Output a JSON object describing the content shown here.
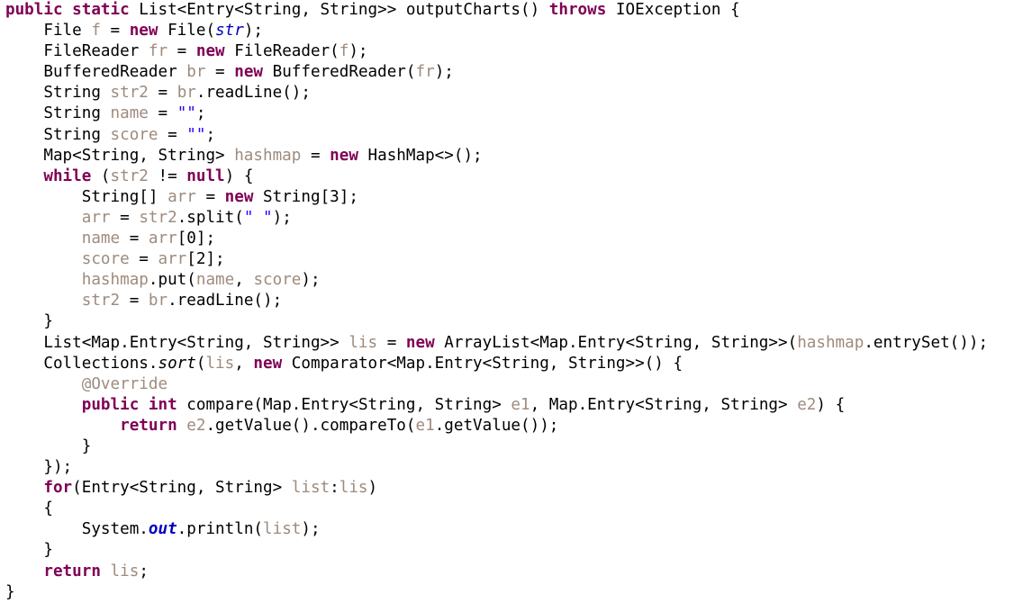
{
  "editor": {
    "language": "Java",
    "background_color": "#ffffff",
    "font_size_px": 17.6,
    "line_height_px": 23.1,
    "indent_spaces": 4
  },
  "theme": {
    "keyword_color": "#7f0055",
    "identifier_color": "#9e8b7d",
    "string_color": "#2a00ff",
    "field_color": "#0000c0",
    "static_field_color": "#0000c0",
    "plain_color": "#000000",
    "annotation_color": "#9e8b7d"
  },
  "code": {
    "plain_text": "public static List<Entry<String, String>> outputCharts() throws IOException {\n    File f = new File(str);\n    FileReader fr = new FileReader(f);\n    BufferedReader br = new BufferedReader(fr);\n    String str2 = br.readLine();\n    String name = \"\";\n    String score = \"\";\n    Map<String, String> hashmap = new HashMap<>();\n    while (str2 != null) {\n        String[] arr = new String[3];\n        arr = str2.split(\" \");\n        name = arr[0];\n        score = arr[2];\n        hashmap.put(name, score);\n        str2 = br.readLine();\n    }\n    List<Map.Entry<String, String>> lis = new ArrayList<Map.Entry<String, String>>(hashmap.entrySet());\n    Collections.sort(lis, new Comparator<Map.Entry<String, String>>() {\n        @Override\n        public int compare(Map.Entry<String, String> e1, Map.Entry<String, String> e2) {\n            return e2.getValue().compareTo(e1.getValue());\n        }\n    });\n    for(Entry<String, String> list:lis)\n    {\n        System.out.println(list);\n    }\n    return lis;\n}",
    "lines": [
      {
        "n": 1,
        "tokens": [
          {
            "c": "keyword",
            "s": "public static"
          },
          {
            "c": "plain",
            "s": " List<Entry<String, String>> outputCharts() "
          },
          {
            "c": "keyword",
            "s": "throws"
          },
          {
            "c": "plain",
            "s": " IOException {"
          }
        ]
      },
      {
        "n": 2,
        "tokens": [
          {
            "c": "plain",
            "s": "    File "
          },
          {
            "c": "ident",
            "s": "f"
          },
          {
            "c": "plain",
            "s": " = "
          },
          {
            "c": "keyword",
            "s": "new"
          },
          {
            "c": "plain",
            "s": " File("
          },
          {
            "c": "field",
            "s": "str"
          },
          {
            "c": "plain",
            "s": ");"
          }
        ]
      },
      {
        "n": 3,
        "tokens": [
          {
            "c": "plain",
            "s": "    FileReader "
          },
          {
            "c": "ident",
            "s": "fr"
          },
          {
            "c": "plain",
            "s": " = "
          },
          {
            "c": "keyword",
            "s": "new"
          },
          {
            "c": "plain",
            "s": " FileReader("
          },
          {
            "c": "ident",
            "s": "f"
          },
          {
            "c": "plain",
            "s": ");"
          }
        ]
      },
      {
        "n": 4,
        "tokens": [
          {
            "c": "plain",
            "s": "    BufferedReader "
          },
          {
            "c": "ident",
            "s": "br"
          },
          {
            "c": "plain",
            "s": " = "
          },
          {
            "c": "keyword",
            "s": "new"
          },
          {
            "c": "plain",
            "s": " BufferedReader("
          },
          {
            "c": "ident",
            "s": "fr"
          },
          {
            "c": "plain",
            "s": ");"
          }
        ]
      },
      {
        "n": 5,
        "tokens": [
          {
            "c": "plain",
            "s": "    String "
          },
          {
            "c": "ident",
            "s": "str2"
          },
          {
            "c": "plain",
            "s": " = "
          },
          {
            "c": "ident",
            "s": "br"
          },
          {
            "c": "plain",
            "s": ".readLine();"
          }
        ]
      },
      {
        "n": 6,
        "tokens": [
          {
            "c": "plain",
            "s": "    String "
          },
          {
            "c": "ident",
            "s": "name"
          },
          {
            "c": "plain",
            "s": " = "
          },
          {
            "c": "string",
            "s": "\"\""
          },
          {
            "c": "plain",
            "s": ";"
          }
        ]
      },
      {
        "n": 7,
        "tokens": [
          {
            "c": "plain",
            "s": "    String "
          },
          {
            "c": "ident",
            "s": "score"
          },
          {
            "c": "plain",
            "s": " = "
          },
          {
            "c": "string",
            "s": "\"\""
          },
          {
            "c": "plain",
            "s": ";"
          }
        ]
      },
      {
        "n": 8,
        "tokens": [
          {
            "c": "plain",
            "s": "    Map<String, String> "
          },
          {
            "c": "ident",
            "s": "hashmap"
          },
          {
            "c": "plain",
            "s": " = "
          },
          {
            "c": "keyword",
            "s": "new"
          },
          {
            "c": "plain",
            "s": " HashMap<>();"
          }
        ]
      },
      {
        "n": 9,
        "tokens": [
          {
            "c": "plain",
            "s": "    "
          },
          {
            "c": "keyword",
            "s": "while"
          },
          {
            "c": "plain",
            "s": " ("
          },
          {
            "c": "ident",
            "s": "str2"
          },
          {
            "c": "plain",
            "s": " != "
          },
          {
            "c": "keyword",
            "s": "null"
          },
          {
            "c": "plain",
            "s": ") {"
          }
        ]
      },
      {
        "n": 10,
        "tokens": [
          {
            "c": "plain",
            "s": "        String[] "
          },
          {
            "c": "ident",
            "s": "arr"
          },
          {
            "c": "plain",
            "s": " = "
          },
          {
            "c": "keyword",
            "s": "new"
          },
          {
            "c": "plain",
            "s": " String[3];"
          }
        ]
      },
      {
        "n": 11,
        "tokens": [
          {
            "c": "plain",
            "s": "        "
          },
          {
            "c": "ident",
            "s": "arr"
          },
          {
            "c": "plain",
            "s": " = "
          },
          {
            "c": "ident",
            "s": "str2"
          },
          {
            "c": "plain",
            "s": ".split("
          },
          {
            "c": "string",
            "s": "\" \""
          },
          {
            "c": "plain",
            "s": ");"
          }
        ]
      },
      {
        "n": 12,
        "tokens": [
          {
            "c": "plain",
            "s": "        "
          },
          {
            "c": "ident",
            "s": "name"
          },
          {
            "c": "plain",
            "s": " = "
          },
          {
            "c": "ident",
            "s": "arr"
          },
          {
            "c": "plain",
            "s": "[0];"
          }
        ]
      },
      {
        "n": 13,
        "tokens": [
          {
            "c": "plain",
            "s": "        "
          },
          {
            "c": "ident",
            "s": "score"
          },
          {
            "c": "plain",
            "s": " = "
          },
          {
            "c": "ident",
            "s": "arr"
          },
          {
            "c": "plain",
            "s": "[2];"
          }
        ]
      },
      {
        "n": 14,
        "tokens": [
          {
            "c": "plain",
            "s": "        "
          },
          {
            "c": "ident",
            "s": "hashmap"
          },
          {
            "c": "plain",
            "s": ".put("
          },
          {
            "c": "ident",
            "s": "name"
          },
          {
            "c": "plain",
            "s": ", "
          },
          {
            "c": "ident",
            "s": "score"
          },
          {
            "c": "plain",
            "s": ");"
          }
        ]
      },
      {
        "n": 15,
        "tokens": [
          {
            "c": "plain",
            "s": "        "
          },
          {
            "c": "ident",
            "s": "str2"
          },
          {
            "c": "plain",
            "s": " = "
          },
          {
            "c": "ident",
            "s": "br"
          },
          {
            "c": "plain",
            "s": ".readLine();"
          }
        ]
      },
      {
        "n": 16,
        "tokens": [
          {
            "c": "plain",
            "s": "    }"
          }
        ]
      },
      {
        "n": 17,
        "tokens": [
          {
            "c": "plain",
            "s": "    List<Map.Entry<String, String>> "
          },
          {
            "c": "ident",
            "s": "lis"
          },
          {
            "c": "plain",
            "s": " = "
          },
          {
            "c": "keyword",
            "s": "new"
          },
          {
            "c": "plain",
            "s": " ArrayList<Map.Entry<String, String>>("
          },
          {
            "c": "ident",
            "s": "hashmap"
          },
          {
            "c": "plain",
            "s": ".entrySet());"
          }
        ]
      },
      {
        "n": 18,
        "tokens": [
          {
            "c": "plain",
            "s": "    Collections."
          },
          {
            "c": "smethod",
            "s": "sort"
          },
          {
            "c": "plain",
            "s": "("
          },
          {
            "c": "ident",
            "s": "lis"
          },
          {
            "c": "plain",
            "s": ", "
          },
          {
            "c": "keyword",
            "s": "new"
          },
          {
            "c": "plain",
            "s": " Comparator<Map.Entry<String, String>>() {"
          }
        ]
      },
      {
        "n": 19,
        "tokens": [
          {
            "c": "plain",
            "s": "        "
          },
          {
            "c": "annot",
            "s": "@Override"
          }
        ]
      },
      {
        "n": 20,
        "tokens": [
          {
            "c": "plain",
            "s": "        "
          },
          {
            "c": "keyword",
            "s": "public int"
          },
          {
            "c": "plain",
            "s": " compare(Map.Entry<String, String> "
          },
          {
            "c": "ident",
            "s": "e1"
          },
          {
            "c": "plain",
            "s": ", Map.Entry<String, String> "
          },
          {
            "c": "ident",
            "s": "e2"
          },
          {
            "c": "plain",
            "s": ") {"
          }
        ]
      },
      {
        "n": 21,
        "tokens": [
          {
            "c": "plain",
            "s": "            "
          },
          {
            "c": "keyword",
            "s": "return"
          },
          {
            "c": "plain",
            "s": " "
          },
          {
            "c": "ident",
            "s": "e2"
          },
          {
            "c": "plain",
            "s": ".getValue().compareTo("
          },
          {
            "c": "ident",
            "s": "e1"
          },
          {
            "c": "plain",
            "s": ".getValue());"
          }
        ]
      },
      {
        "n": 22,
        "tokens": [
          {
            "c": "plain",
            "s": "        }"
          }
        ]
      },
      {
        "n": 23,
        "tokens": [
          {
            "c": "plain",
            "s": "    });"
          }
        ]
      },
      {
        "n": 24,
        "tokens": [
          {
            "c": "plain",
            "s": "    "
          },
          {
            "c": "keyword",
            "s": "for"
          },
          {
            "c": "plain",
            "s": "(Entry<String, String> "
          },
          {
            "c": "ident",
            "s": "list"
          },
          {
            "c": "plain",
            "s": ":"
          },
          {
            "c": "ident",
            "s": "lis"
          },
          {
            "c": "plain",
            "s": ")"
          }
        ]
      },
      {
        "n": 25,
        "tokens": [
          {
            "c": "plain",
            "s": "    {"
          }
        ]
      },
      {
        "n": 26,
        "tokens": [
          {
            "c": "plain",
            "s": "        System."
          },
          {
            "c": "sfield",
            "s": "out"
          },
          {
            "c": "plain",
            "s": ".println("
          },
          {
            "c": "ident",
            "s": "list"
          },
          {
            "c": "plain",
            "s": ");"
          }
        ]
      },
      {
        "n": 27,
        "tokens": [
          {
            "c": "plain",
            "s": "    }"
          }
        ]
      },
      {
        "n": 28,
        "tokens": [
          {
            "c": "plain",
            "s": "    "
          },
          {
            "c": "keyword",
            "s": "return"
          },
          {
            "c": "plain",
            "s": " "
          },
          {
            "c": "ident",
            "s": "lis"
          },
          {
            "c": "plain",
            "s": ";"
          }
        ]
      },
      {
        "n": 29,
        "tokens": [
          {
            "c": "plain",
            "s": "}"
          }
        ]
      }
    ]
  }
}
